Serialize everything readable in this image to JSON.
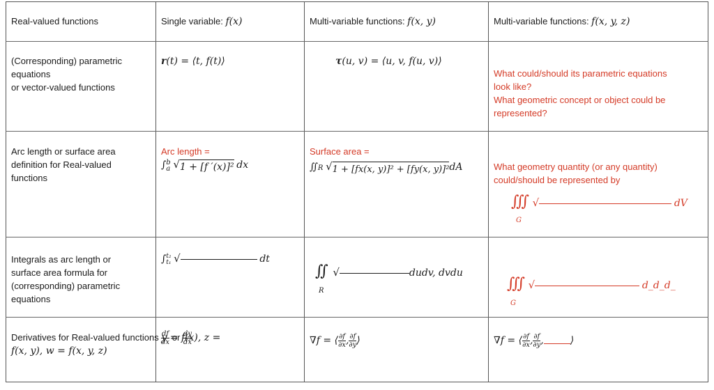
{
  "header": {
    "col0": "Real-valued functions",
    "col1_label": "Single variable: ",
    "col1_math": "f(x)",
    "col2_label": "Multi-variable functions: ",
    "col2_math": "f(x, y)",
    "col3_label": "Multi-variable functions: ",
    "col3_math": "f(x, y, z)"
  },
  "rows": [
    {
      "label": [
        "(Corresponding) parametric",
        "equations",
        "or vector-valued functions"
      ],
      "single_var": {
        "vec": "r",
        "rest": "(t) = ⟨t, f(t)⟩"
      },
      "two_var": {
        "vec": "τ",
        "rest": "(u, v) = ⟨u, v, f(u, v)⟩"
      },
      "three_var": [
        "What could/should its parametric equations",
        "look like?",
        "What geometric concept or object could be",
        "represented?"
      ]
    },
    {
      "label": [
        "Arc length or surface area",
        "definition for Real-valued",
        "functions"
      ],
      "single_var": {
        "title": "Arc length =",
        "integral": "∫",
        "lower": "a",
        "upper": "b",
        "radicand": "1 + [f ′(x)]²",
        "differential": "dx"
      },
      "two_var": {
        "title": "Surface area =",
        "integral": "∬",
        "region": "R",
        "radicand": "1 + [fx(x, y)]² + [fy(x, y)]²",
        "differential": "dA"
      },
      "three_var": {
        "question": [
          "What geometry quantity (or any quantity)",
          "could/should be represented by"
        ],
        "integral": "∭",
        "region": "G",
        "differential": "dV"
      }
    },
    {
      "label": [
        "Integrals as arc length or",
        "surface area formula for",
        "(corresponding) parametric",
        "equations"
      ],
      "single_var": {
        "integral": "∫",
        "lower": "t₁",
        "upper": "t₂",
        "differential": "dt"
      },
      "two_var": {
        "integral": "∬",
        "region": "R",
        "differential": "dudv, dvdu"
      },
      "three_var": {
        "integral": "∭",
        "region": "G",
        "differential": "d_d_d_"
      }
    },
    {
      "label_text": "Derivatives for Real-valued functions ",
      "label_math": [
        "y = f(x), z =",
        "f(x, y), w = f(x, y, z)"
      ],
      "single_var": {
        "frac1_num": "df",
        "frac1_den": "dx",
        "or": "or",
        "frac2_num": "dy",
        "frac2_den": "dx"
      },
      "two_var": {
        "prefix": "∇f = ⟨",
        "p1_num": "∂f",
        "p1_den": "∂x",
        "p2_num": "∂f",
        "p2_den": "∂y",
        "suffix": "⟩"
      },
      "three_var": {
        "prefix": "∇f = ⟨",
        "p1_num": "∂f",
        "p1_den": "∂x",
        "p2_num": "∂f",
        "p2_den": "∂y",
        "suffix": "⟩"
      }
    }
  ],
  "colors": {
    "accent_red": "#d43a26",
    "grid": "#555555"
  }
}
